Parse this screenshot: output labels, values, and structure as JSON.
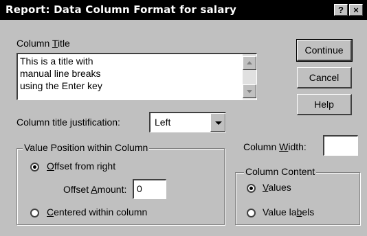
{
  "window": {
    "title": "Report: Data Column Format for salary",
    "help_btn": "?",
    "close_btn": "×"
  },
  "column_title": {
    "label_pre": "Column ",
    "label_key": "T",
    "label_post": "itle",
    "text": "This is a title with\nmanual line breaks\nusing the Enter key"
  },
  "buttons": {
    "continue": "Continue",
    "cancel": "Cancel",
    "help": "Help"
  },
  "justification": {
    "label": "Column title justification:",
    "value": "Left"
  },
  "column_width": {
    "label_pre": "Column ",
    "label_key": "W",
    "label_post": "idth:",
    "value": ""
  },
  "value_position": {
    "title": "Value Position within Column",
    "offset_right_key": "O",
    "offset_right_rest": "ffset from right",
    "offset_amount_pre": "Offset ",
    "offset_amount_key": "A",
    "offset_amount_post": "mount:",
    "offset_amount_value": "0",
    "centered_key": "C",
    "centered_rest": "entered within column",
    "selected": "offset_from_right"
  },
  "column_content": {
    "title": "Column Content",
    "values_key": "V",
    "values_rest": "alues",
    "value_labels_pre": "Value la",
    "value_labels_key": "b",
    "value_labels_post": "els",
    "selected": "values"
  }
}
